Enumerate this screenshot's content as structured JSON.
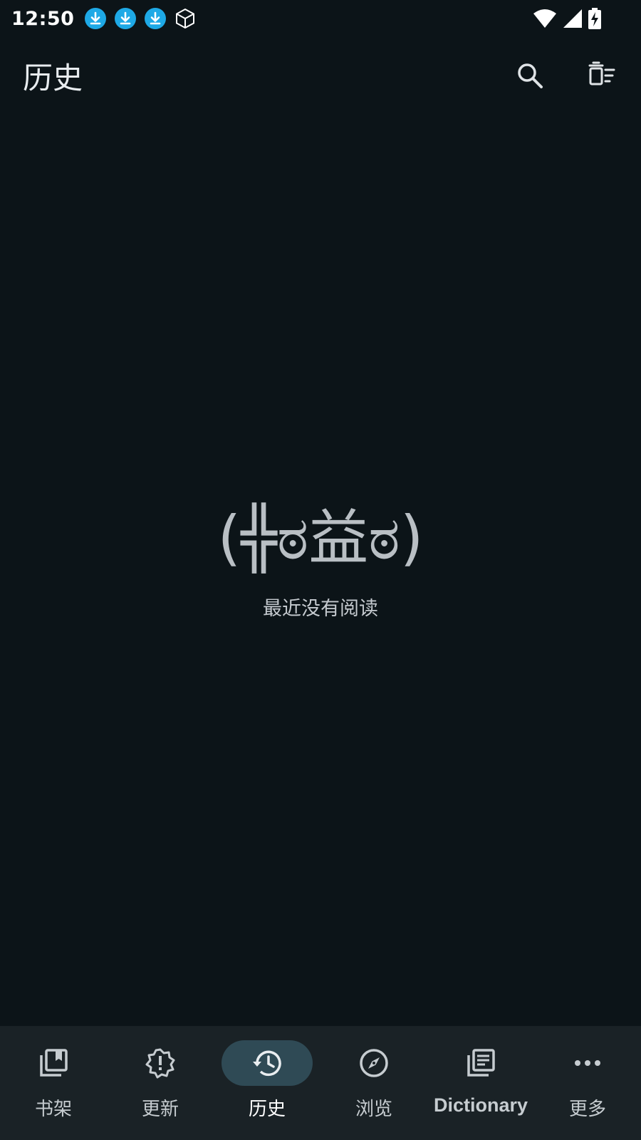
{
  "status_bar": {
    "time": "12:50",
    "download_icon_color": "#1ea9e6",
    "icons": [
      "download-icon",
      "download-icon",
      "download-icon",
      "cube-icon",
      "wifi-icon",
      "signal-icon",
      "battery-charging-icon"
    ]
  },
  "app_bar": {
    "title": "历史",
    "actions": [
      "search-icon",
      "delete-sweep-icon"
    ]
  },
  "empty_state": {
    "face": "(╬ಠ益ಠ)",
    "message": "最近没有阅读"
  },
  "bottom_nav": {
    "active_index": 2,
    "items": [
      {
        "label": "书架",
        "icon": "library-icon"
      },
      {
        "label": "更新",
        "icon": "updates-alert-icon"
      },
      {
        "label": "历史",
        "icon": "history-icon"
      },
      {
        "label": "浏览",
        "icon": "compass-icon"
      },
      {
        "label": "Dictionary",
        "icon": "dictionary-icon"
      },
      {
        "label": "更多",
        "icon": "more-horizontal-icon"
      }
    ]
  },
  "colors": {
    "background": "#0c1418",
    "nav_background": "#1a2226",
    "active_pill": "#2f4a55",
    "icon": "#c6ccd0"
  }
}
